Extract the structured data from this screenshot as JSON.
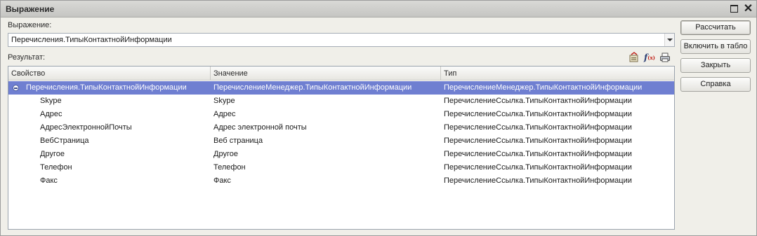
{
  "window": {
    "title": "Выражение"
  },
  "expression": {
    "label": "Выражение:",
    "value": "Перечисления.ТипыКонтактнойИнформации"
  },
  "result": {
    "label": "Результат:"
  },
  "toolbar": {
    "fx_label": "f",
    "fx_sub": "(x)"
  },
  "table": {
    "columns": [
      "Свойство",
      "Значение",
      "Тип"
    ],
    "rows": [
      {
        "property": "Перечисления.ТипыКонтактнойИнформации",
        "value": "ПеречислениеМенеджер.ТипыКонтактнойИнформации",
        "type": "ПеречислениеМенеджер.ТипыКонтактнойИнформации"
      },
      {
        "property": "Skype",
        "value": "Skype",
        "type": "ПеречислениеСсылка.ТипыКонтактнойИнформации"
      },
      {
        "property": "Адрес",
        "value": "Адрес",
        "type": "ПеречислениеСсылка.ТипыКонтактнойИнформации"
      },
      {
        "property": "АдресЭлектроннойПочты",
        "value": "Адрес электронной почты",
        "type": "ПеречислениеСсылка.ТипыКонтактнойИнформации"
      },
      {
        "property": "ВебСтраница",
        "value": "Веб страница",
        "type": "ПеречислениеСсылка.ТипыКонтактнойИнформации"
      },
      {
        "property": "Другое",
        "value": "Другое",
        "type": "ПеречислениеСсылка.ТипыКонтактнойИнформации"
      },
      {
        "property": "Телефон",
        "value": "Телефон",
        "type": "ПеречислениеСсылка.ТипыКонтактнойИнформации"
      },
      {
        "property": "Факс",
        "value": "Факс",
        "type": "ПеречислениеСсылка.ТипыКонтактнойИнформации"
      }
    ]
  },
  "buttons": {
    "calculate": "Рассчитать",
    "add_to_table": "Включить в табло",
    "close": "Закрыть",
    "help": "Справка"
  },
  "colors": {
    "selection": "#6f7fd1",
    "fx_accent": "#c2261d"
  }
}
